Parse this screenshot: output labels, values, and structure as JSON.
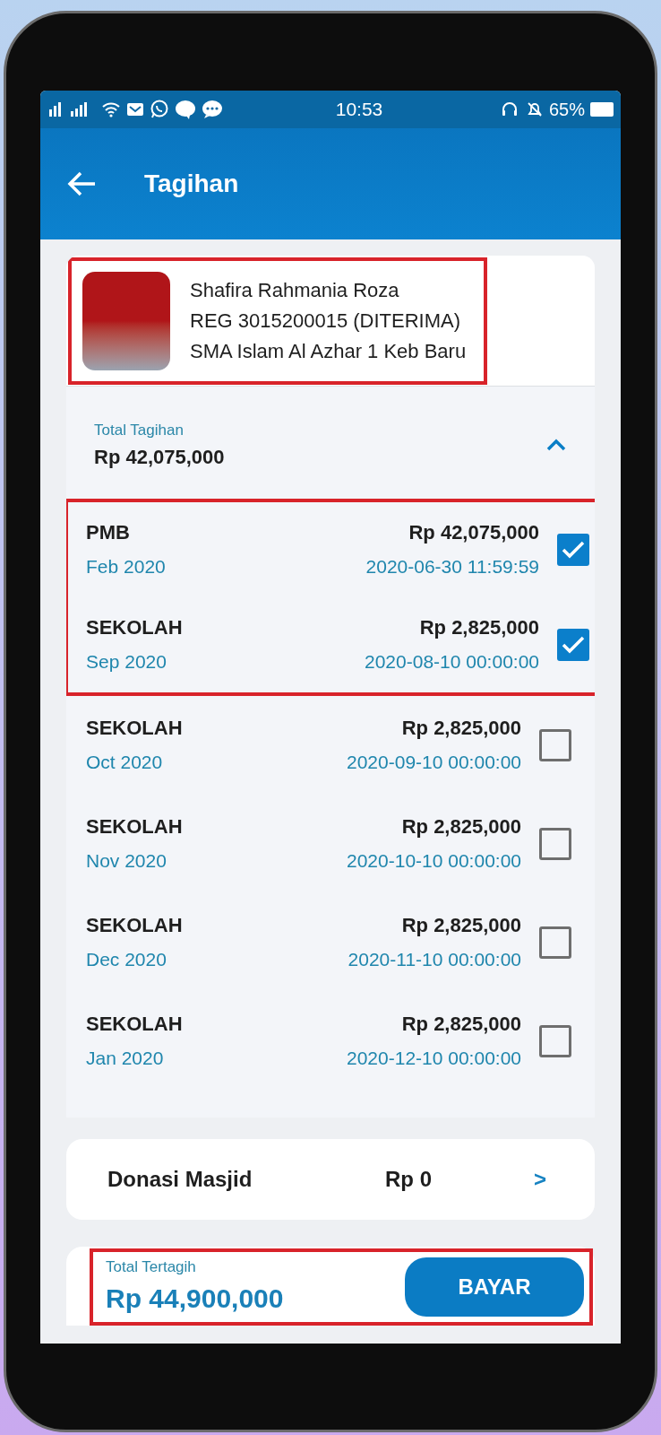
{
  "status_bar": {
    "time": "10:53",
    "battery": "65%"
  },
  "header": {
    "title": "Tagihan"
  },
  "profile": {
    "name": "Shafira Rahmania Roza",
    "registration": "REG 3015200015 (DITERIMA)",
    "school": "SMA Islam Al Azhar 1 Keb Baru",
    "highlighted": true
  },
  "total": {
    "label": "Total Tagihan",
    "amount": "Rp 42,075,000",
    "expanded": true
  },
  "bills": [
    {
      "category": "PMB",
      "period": "Feb 2020",
      "amount": "Rp 42,075,000",
      "due": "2020-06-30 11:59:59",
      "checked": true,
      "highlighted": true
    },
    {
      "category": "SEKOLAH",
      "period": "Sep 2020",
      "amount": "Rp 2,825,000",
      "due": "2020-08-10 00:00:00",
      "checked": true,
      "highlighted": true
    },
    {
      "category": "SEKOLAH",
      "period": "Oct 2020",
      "amount": "Rp 2,825,000",
      "due": "2020-09-10 00:00:00",
      "checked": false,
      "highlighted": false
    },
    {
      "category": "SEKOLAH",
      "period": "Nov 2020",
      "amount": "Rp 2,825,000",
      "due": "2020-10-10 00:00:00",
      "checked": false,
      "highlighted": false
    },
    {
      "category": "SEKOLAH",
      "period": "Dec 2020",
      "amount": "Rp 2,825,000",
      "due": "2020-11-10 00:00:00",
      "checked": false,
      "highlighted": false
    },
    {
      "category": "SEKOLAH",
      "period": "Jan 2020",
      "amount": "Rp 2,825,000",
      "due": "2020-12-10 00:00:00",
      "checked": false,
      "highlighted": false
    }
  ],
  "donation": {
    "label": "Donasi Masjid",
    "amount": "Rp 0",
    "arrow": ">"
  },
  "footer": {
    "label": "Total Tertagih",
    "amount": "Rp 44,900,000",
    "button": "BAYAR",
    "highlighted": true
  }
}
